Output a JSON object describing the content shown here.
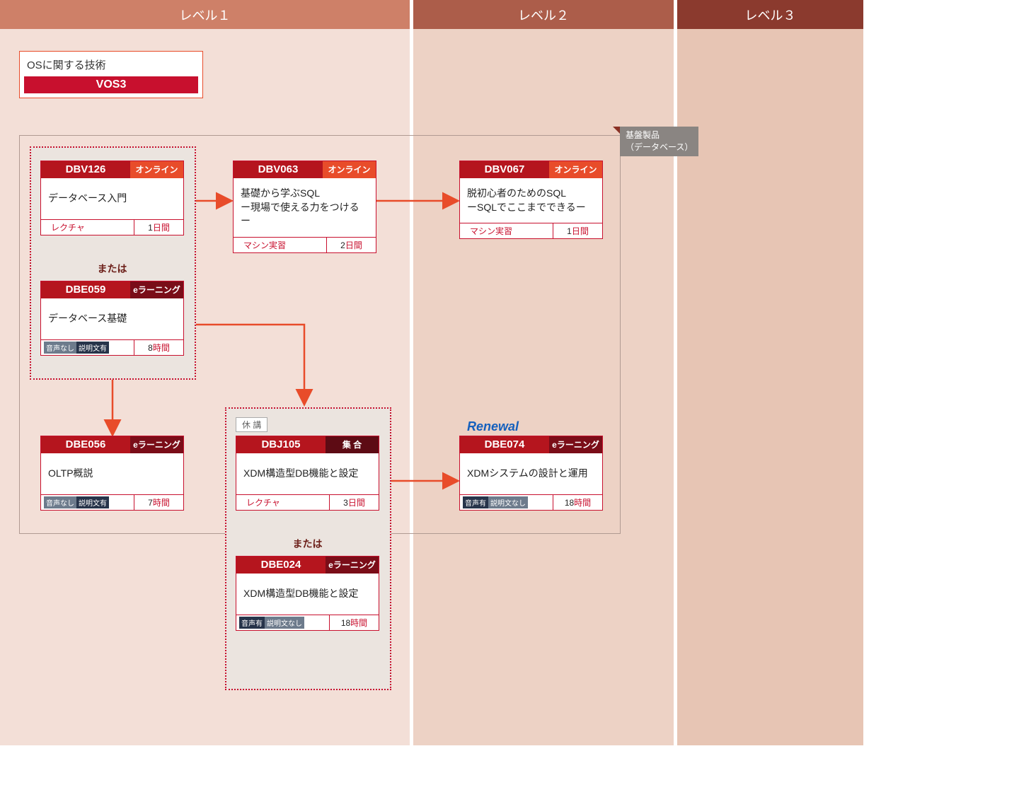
{
  "levels": {
    "l1": "レベル１",
    "l2": "レベル２",
    "l3": "レベル３"
  },
  "osBox": {
    "title": "OSに関する技術",
    "vos3": "VOS3"
  },
  "groupTag": {
    "line1": "基盤製品",
    "line2": "（データベース）"
  },
  "orLabel": "または",
  "suspended": "休 講",
  "renewal": "Renewal",
  "badges": {
    "audioNo": "音声なし",
    "descYes": "説明文有",
    "audioYes": "音声有",
    "descNo": "説明文なし"
  },
  "types": {
    "online": "オンライン",
    "elearn": "eラーニング",
    "class": "集 合"
  },
  "footerLabels": {
    "lecture": "レクチャ",
    "machine": "マシン実習"
  },
  "units": {
    "day": "日間",
    "hour": "時間"
  },
  "courses": {
    "dbv126": {
      "code": "DBV126",
      "title": "データベース入門",
      "dur": "1"
    },
    "dbe059": {
      "code": "DBE059",
      "title": "データベース基礎",
      "dur": "8"
    },
    "dbv063": {
      "code": "DBV063",
      "title": "基礎から学ぶSQL\nー現場で使える力をつけるー",
      "dur": "2"
    },
    "dbv067": {
      "code": "DBV067",
      "title": "脱初心者のためのSQL\nーSQLでここまでできるー",
      "dur": "1"
    },
    "dbe056": {
      "code": "DBE056",
      "title": "OLTP概説",
      "dur": "7"
    },
    "dbj105": {
      "code": "DBJ105",
      "title": "XDM構造型DB機能と設定",
      "dur": "3"
    },
    "dbe024": {
      "code": "DBE024",
      "title": "XDM構造型DB機能と設定",
      "dur": "18"
    },
    "dbe074": {
      "code": "DBE074",
      "title": "XDMシステムの設計と運用",
      "dur": "18"
    }
  }
}
